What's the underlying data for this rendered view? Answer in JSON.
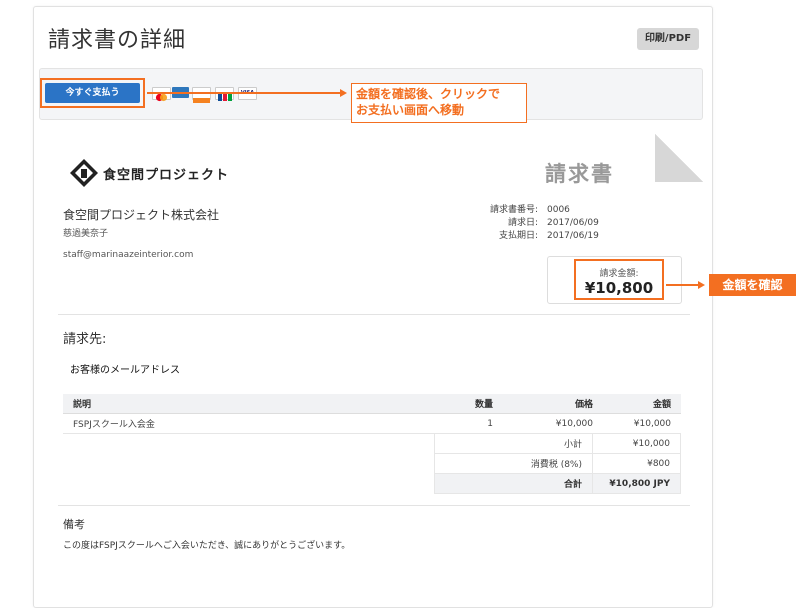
{
  "page": {
    "title": "請求書の詳細",
    "print_label": "印刷/PDF"
  },
  "paybar": {
    "pay_now_label": "今すぐ支払う",
    "card_icons": [
      "mastercard-icon",
      "amex-icon",
      "discover-icon",
      "jcb-icon",
      "visa-icon"
    ]
  },
  "callouts": {
    "pay_line1": "金額を確認後、クリックで",
    "pay_line2": "お支払い画面へ移動",
    "amount": "金額を確認"
  },
  "invoice": {
    "logo_text": "食空間プロジェクト",
    "doc_title": "請求書",
    "company_name": "食空間プロジェクト株式会社",
    "contact_name": "慈過美奈子",
    "email": "staff@marinaazeinterior.com",
    "meta": {
      "number_label": "請求書番号:",
      "number": "0006",
      "date_label": "請求日:",
      "date": "2017/06/09",
      "due_label": "支払期日:",
      "due": "2017/06/19"
    },
    "amount_label": "請求金額:",
    "amount_value": "¥10,800",
    "bill_to_label": "請求先:",
    "bill_to_name": "お客様のメールアドレス",
    "table": {
      "headers": [
        "説明",
        "数量",
        "価格",
        "金額"
      ],
      "rows": [
        {
          "desc": "FSPJスクール入会金",
          "qty": "1",
          "price": "¥10,000",
          "amount": "¥10,000"
        }
      ]
    },
    "summary": {
      "subtotal_label": "小計",
      "subtotal": "¥10,000",
      "tax_label": "消費税 (8%)",
      "tax": "¥800",
      "total_label": "合計",
      "total": "¥10,800 JPY"
    },
    "notes_label": "備考",
    "notes_text": "この度はFSPJスクールへご入会いただき、誠にありがとうございます。"
  },
  "colors": {
    "accent": "#f36f21",
    "primary_button": "#2b74c6"
  }
}
